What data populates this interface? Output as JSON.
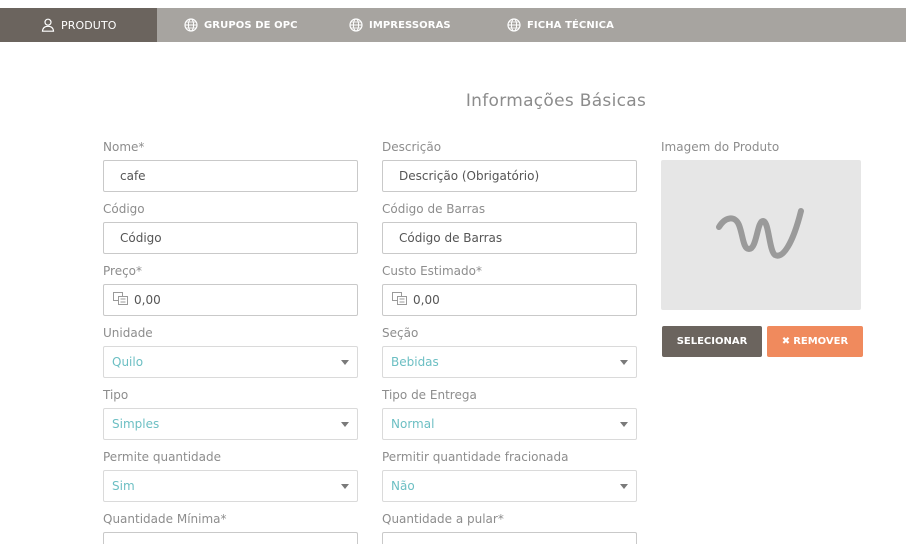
{
  "tabs": [
    {
      "label": "PRODUTO",
      "icon": "user-icon",
      "active": true
    },
    {
      "label": "GRUPOS DE OPC",
      "icon": "globe-icon"
    },
    {
      "label": "IMPRESSORAS",
      "icon": "globe-icon"
    },
    {
      "label": "FICHA TÉCNICA",
      "icon": "globe-icon"
    }
  ],
  "section_title": "Informações Básicas",
  "form": {
    "nome": {
      "label": "Nome*",
      "value": "cafe"
    },
    "descricao": {
      "label": "Descrição",
      "placeholder": "Descrição (Obrigatório)"
    },
    "codigo": {
      "label": "Código",
      "placeholder": "Código"
    },
    "codigo_barras": {
      "label": "Código de Barras",
      "placeholder": "Código de Barras"
    },
    "preco": {
      "label": "Preço*",
      "value": "0,00"
    },
    "custo": {
      "label": "Custo Estimado*",
      "value": "0,00"
    },
    "unidade": {
      "label": "Unidade",
      "value": "Quilo"
    },
    "secao": {
      "label": "Seção",
      "value": "Bebidas"
    },
    "tipo": {
      "label": "Tipo",
      "value": "Simples"
    },
    "tipo_entrega": {
      "label": "Tipo de Entrega",
      "value": "Normal"
    },
    "permite_qtd": {
      "label": "Permite quantidade",
      "value": "Sim"
    },
    "qtd_fracionada": {
      "label": "Permitir quantidade fracionada",
      "value": "Não"
    },
    "qtd_minima": {
      "label": "Quantidade Mínima*"
    },
    "qtd_pular": {
      "label": "Quantidade a pular*"
    }
  },
  "image": {
    "label": "Imagem do Produto",
    "select_label": "SELECIONAR",
    "remove_label": "REMOVER"
  },
  "colors": {
    "tab_bar": "#a7a4a0",
    "tab_active": "#6b645e",
    "select_text": "#6cbfc3",
    "remove_button": "#f08a5d"
  }
}
